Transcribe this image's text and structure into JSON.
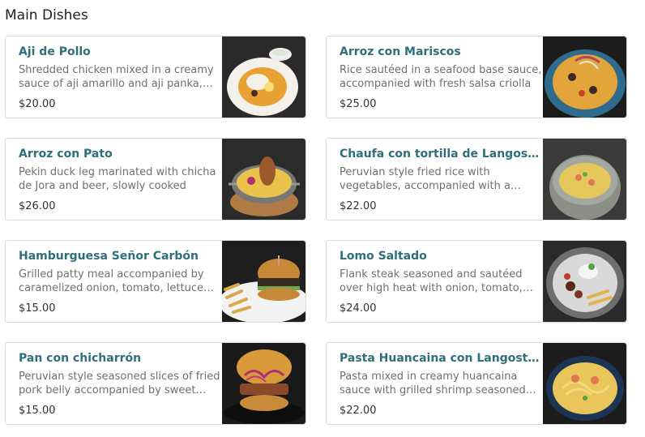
{
  "section": {
    "title": "Main Dishes"
  },
  "dishes": [
    {
      "name": "Aji de Pollo",
      "description": "Shredded chicken mixed in a creamy sauce of aji amarillo and aji panka, served with white rice",
      "price": "$20.00",
      "image": "aji-de-pollo-photo"
    },
    {
      "name": "Arroz con Mariscos",
      "description": "Rice sautéed in a seafood base sauce, accompanied with fresh salsa criolla",
      "price": "$25.00",
      "image": "arroz-con-mariscos-photo"
    },
    {
      "name": "Arroz con Pato",
      "description": "Pekin duck leg marinated with chicha de Jora and beer, slowly cooked",
      "price": "$26.00",
      "image": "arroz-con-pato-photo"
    },
    {
      "name": "Chaufa con tortilla de Langostinos",
      "description": "Peruvian style fried rice with vegetables, accompanied with a shrimp omelette",
      "price": "$22.00",
      "image": "chaufa-photo"
    },
    {
      "name": "Hamburguesa Señor Carbón",
      "description": "Grilled patty meal accompanied by caramelized onion, tomato, lettuce and fries",
      "price": "$15.00",
      "image": "hamburguesa-photo"
    },
    {
      "name": "Lomo Saltado",
      "description": "Flank steak seasoned and sautéed over high heat with onion, tomato, and fries",
      "price": "$24.00",
      "image": "lomo-saltado-photo"
    },
    {
      "name": "Pan con chicharrón",
      "description": "Peruvian style seasoned slices of fried pork belly accompanied by sweet potato",
      "price": "$15.00",
      "image": "pan-con-chicharron-photo"
    },
    {
      "name": "Pasta Huancaina con Langostinos",
      "description": "Pasta mixed in creamy huancaina sauce with grilled shrimp seasoned with spices",
      "price": "$22.00",
      "image": "pasta-huancaina-photo"
    }
  ],
  "colors": {
    "dish_name": "#2e6f7a",
    "description": "#6f6f6f",
    "price": "#333333",
    "card_border": "#dcdcdc"
  }
}
